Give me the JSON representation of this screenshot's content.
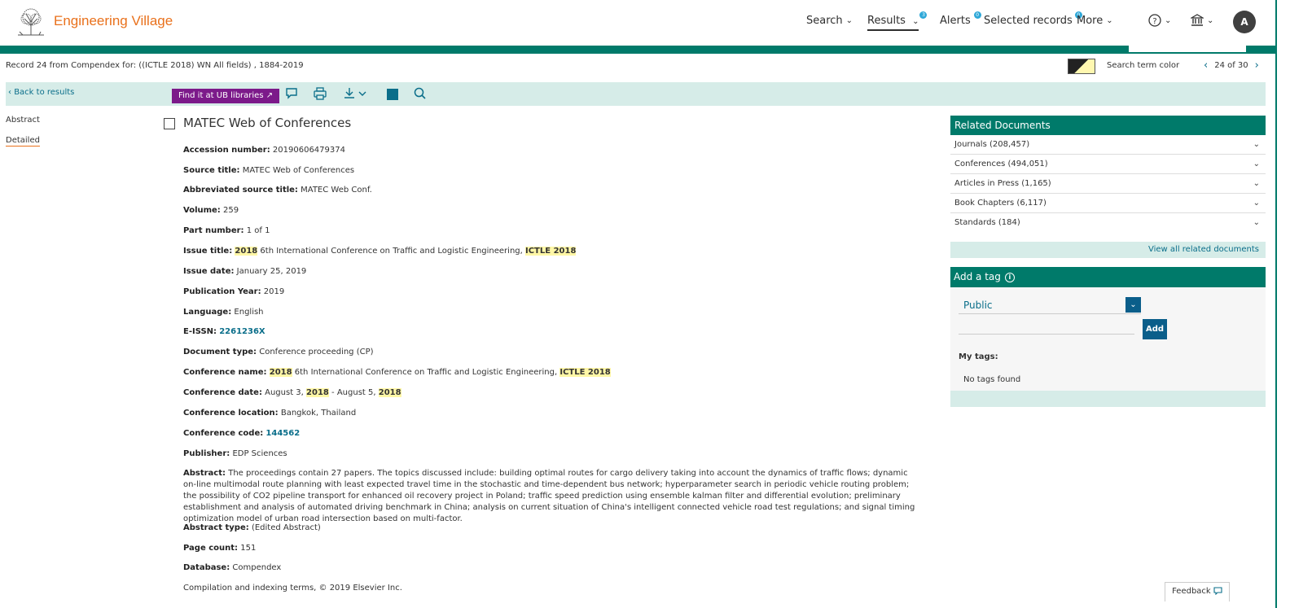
{
  "header": {
    "brand": "Engineering Village",
    "nav": [
      {
        "label": "Search",
        "chevron": true
      },
      {
        "label": "Results",
        "chevron": true,
        "badge": "3"
      },
      {
        "label": "Alerts",
        "badge": "0"
      },
      {
        "label": "Selected records",
        "badge": "0"
      },
      {
        "label": "More",
        "chevron": true
      }
    ],
    "avatar": "A"
  },
  "record": {
    "summary": "Record 24 from Compendex for: ((ICTLE 2018) WN All fields) , 1884-2019",
    "search_term_color_label": "Search term color",
    "pager": "24 of 30"
  },
  "toolbar": {
    "back": "Back to results",
    "find_it": "Find it at UB libraries"
  },
  "left_nav": {
    "abstract": "Abstract",
    "detailed": "Detailed"
  },
  "doc": {
    "title": "MATEC Web of Conferences",
    "accession_label": "Accession number:",
    "accession": "20190606479374",
    "source_label": "Source title:",
    "source": "MATEC Web of Conferences",
    "abbr_label": "Abbreviated source title:",
    "abbr": "MATEC Web Conf.",
    "volume_label": "Volume:",
    "volume": "259",
    "part_label": "Part number:",
    "part": "1 of 1",
    "issue_title_label": "Issue title:",
    "issue_title_hl1": "2018",
    "issue_title_mid": " 6th International Conference on Traffic and Logistic Engineering, ",
    "issue_title_hl2": "ICTLE 2018",
    "issue_date_label": "Issue date:",
    "issue_date": "January 25, 2019",
    "pub_year_label": "Publication Year:",
    "pub_year": "2019",
    "language_label": "Language:",
    "language": "English",
    "eissn_label": "E-ISSN:",
    "eissn": "2261236X",
    "doctype_label": "Document type:",
    "doctype": "Conference proceeding (CP)",
    "conf_name_label": "Conference name:",
    "conf_name_hl1": "2018",
    "conf_name_mid": " 6th International Conference on Traffic and Logistic Engineering, ",
    "conf_name_hl2": "ICTLE 2018",
    "conf_date_label": "Conference date:",
    "conf_date_a": " August 3, ",
    "conf_date_hl1": "2018",
    "conf_date_b": " - August 5, ",
    "conf_date_hl2": "2018",
    "conf_loc_label": "Conference location:",
    "conf_loc": "Bangkok, Thailand",
    "conf_code_label": "Conference code:",
    "conf_code": "144562",
    "publisher_label": "Publisher:",
    "publisher": "EDP Sciences",
    "abstract_label": "Abstract:",
    "abstract": "The proceedings contain 27 papers. The topics discussed include: building optimal routes for cargo delivery taking into account the dynamics of traffic flows; dynamic on-line multimodal route planning with least expected travel time in the stochastic and time-dependent bus network; hyperparameter search in periodic vehicle routing problem; the possibility of CO2 pipeline transport for enhanced oil recovery project in Poland; traffic speed prediction using ensemble kalman filter and differential evolution; preliminary establishment and analysis of automated driving benchmark in China; analysis on current situation of China's intelligent connected vehicle road test regulations; and signal timing optimization model of urban road intersection based on multi-factor.",
    "abstract_type_label": "Abstract type:",
    "abstract_type": "(Edited Abstract)",
    "page_count_label": "Page count:",
    "page_count": "151",
    "database_label": "Database:",
    "database": "Compendex",
    "copyright": "Compilation and indexing terms, © 2019 Elsevier Inc."
  },
  "related": {
    "title": "Related Documents",
    "items": [
      "Journals (208,457)",
      "Conferences (494,051)",
      "Articles in Press (1,165)",
      "Book Chapters (6,117)",
      "Standards (184)"
    ],
    "view_all": "View all related documents"
  },
  "tag": {
    "title": "Add a tag",
    "visibility": "Public",
    "add": "Add",
    "my_tags": "My tags:",
    "no_tags": "No tags found"
  },
  "feedback": "Feedback",
  "colors": {
    "brand": "#e9711c",
    "green": "#007a6a",
    "light_green": "#d6ece8",
    "purple": "#7c1a8a",
    "link": "#0a6e8a"
  }
}
